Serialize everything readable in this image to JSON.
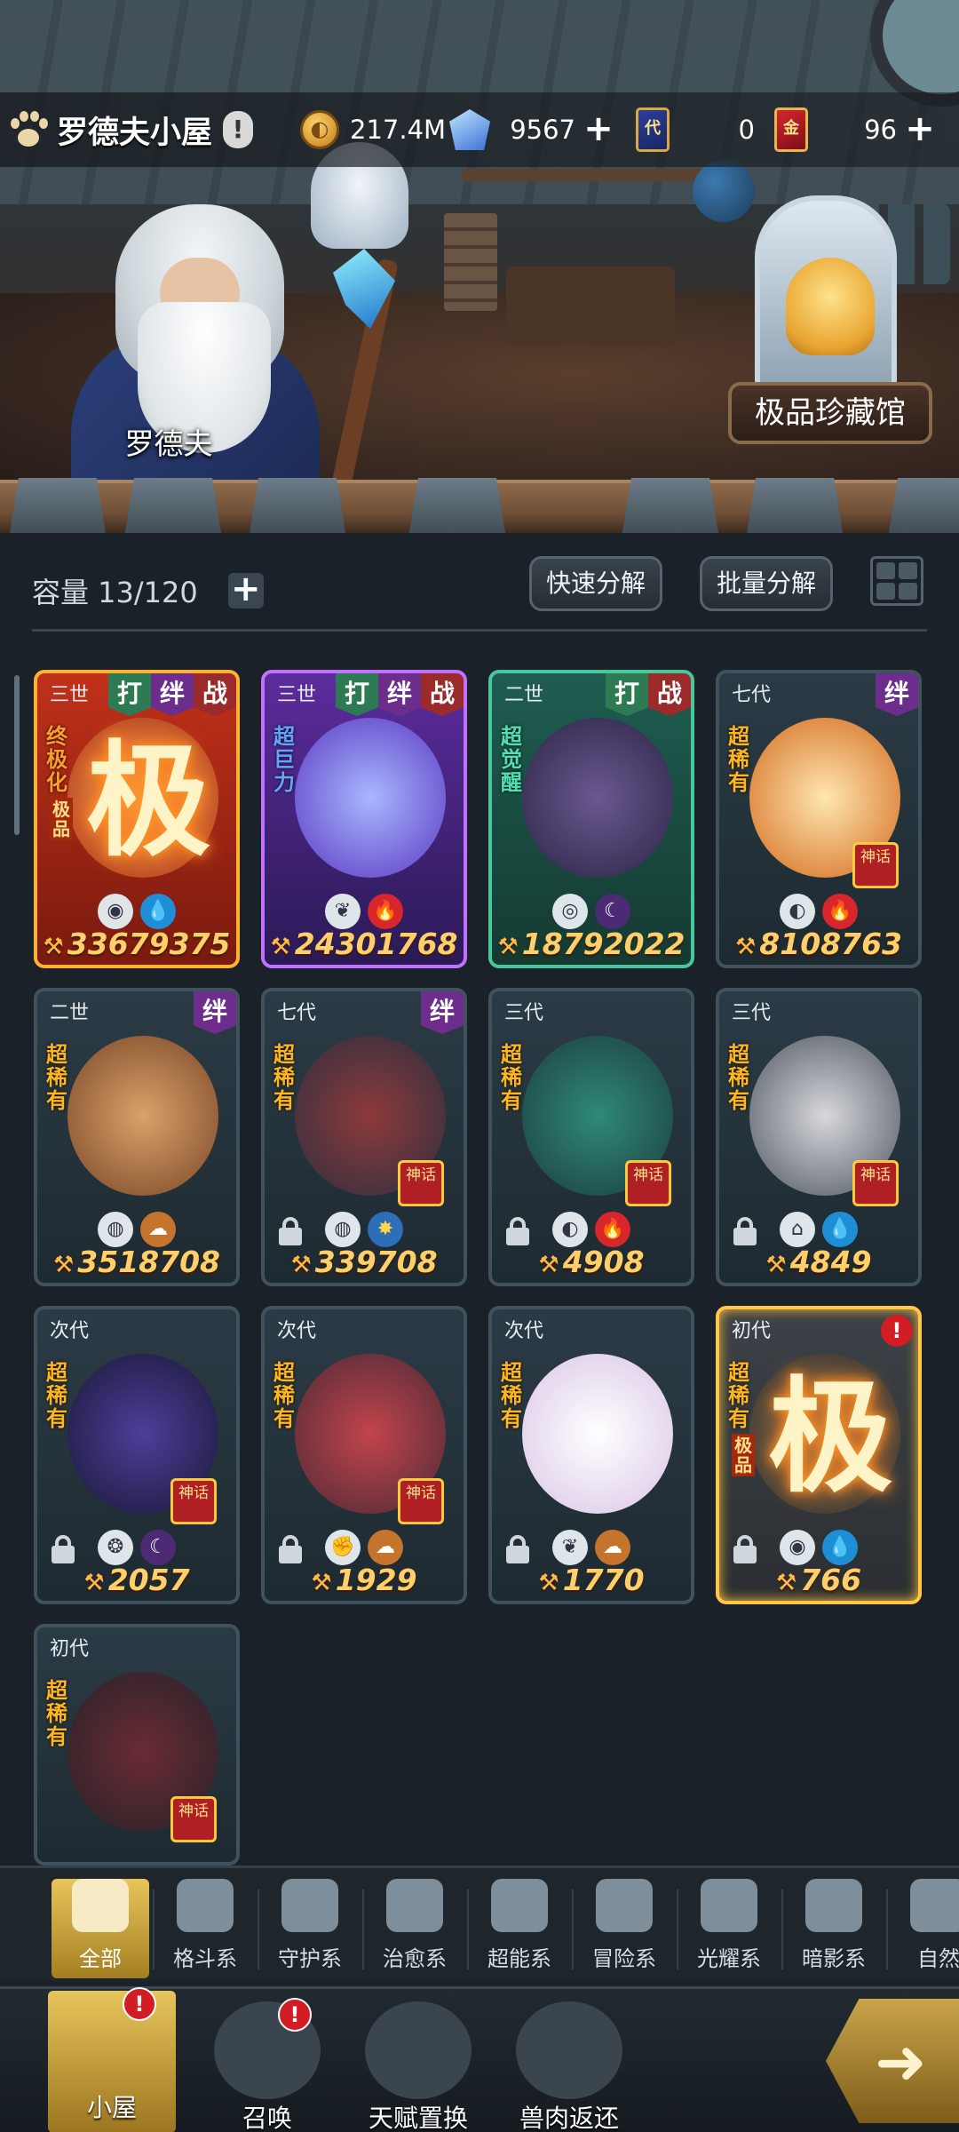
{
  "header": {
    "title": "罗德夫小屋",
    "warn": "!",
    "coins": "217.4M",
    "crystals": "9567",
    "gen_cards": "0",
    "gen_card_icon": "代",
    "gold_cards": "96",
    "gold_card_icon": "金"
  },
  "scene": {
    "npc_name": "罗德夫",
    "museum_label": "极品珍藏馆"
  },
  "toolbar": {
    "capacity_label": "容量 13/120",
    "quick_dismantle": "快速分解",
    "batch_dismantle": "批量分解"
  },
  "cards": [
    {
      "gen": "三世",
      "tags": [
        "打",
        "绊",
        "战"
      ],
      "rarity": "终极化",
      "sub": "极品",
      "big": "极",
      "elements": [
        "◉",
        "💧"
      ],
      "power": "33679375"
    },
    {
      "gen": "三世",
      "tags": [
        "打",
        "绊",
        "战"
      ],
      "rarity": "超巨力",
      "elements": [
        "❦",
        "🔥"
      ],
      "power": "24301768"
    },
    {
      "gen": "二世",
      "tags": [
        "打",
        "战"
      ],
      "rarity": "超觉醒",
      "elements": [
        "◎",
        "☾"
      ],
      "power": "18792022"
    },
    {
      "gen": "七代",
      "tags": [
        "绊"
      ],
      "rarity": "超稀有",
      "mythic": "神话",
      "elements": [
        "◐",
        "🔥"
      ],
      "power": "8108763"
    },
    {
      "gen": "二世",
      "tags": [
        "绊"
      ],
      "rarity": "超稀有",
      "elements": [
        "◍",
        "☁"
      ],
      "power": "3518708"
    },
    {
      "gen": "七代",
      "tags": [
        "绊"
      ],
      "rarity": "超稀有",
      "mythic": "神话",
      "elements": [
        "◍",
        "✸"
      ],
      "power": "339708"
    },
    {
      "gen": "三代",
      "tags": [],
      "rarity": "超稀有",
      "mythic": "神话",
      "elements": [
        "◐",
        "🔥"
      ],
      "power": "4908"
    },
    {
      "gen": "三代",
      "tags": [],
      "rarity": "超稀有",
      "mythic": "神话",
      "elements": [
        "⌂",
        "💧"
      ],
      "power": "4849"
    },
    {
      "gen": "次代",
      "tags": [],
      "rarity": "超稀有",
      "mythic": "神话",
      "elements": [
        "❂",
        "☾"
      ],
      "power": "2057"
    },
    {
      "gen": "次代",
      "tags": [],
      "rarity": "超稀有",
      "mythic": "神话",
      "elements": [
        "✊",
        "☁"
      ],
      "power": "1929"
    },
    {
      "gen": "次代",
      "tags": [],
      "rarity": "超稀有",
      "elements": [
        "❦",
        "☁"
      ],
      "power": "1770"
    },
    {
      "gen": "初代",
      "tags": [],
      "rarity": "超稀有",
      "sub": "极品",
      "big": "极",
      "elements": [
        "◉",
        "💧"
      ],
      "power": "766",
      "alert": "!"
    },
    {
      "gen": "初代",
      "tags": [],
      "rarity": "超稀有",
      "mythic": "神话",
      "elements": [],
      "power": ""
    }
  ],
  "categories": [
    "全部",
    "格斗系",
    "守护系",
    "治愈系",
    "超能系",
    "冒险系",
    "光耀系",
    "暗影系",
    "自然"
  ],
  "nav": [
    {
      "label": "小屋",
      "badge": "!"
    },
    {
      "label": "召唤",
      "badge": "!"
    },
    {
      "label": "天赋置换",
      "badge": ""
    },
    {
      "label": "兽肉返还",
      "badge": ""
    }
  ],
  "colors": {
    "accent_gold": "#e7c55a",
    "power_text": "#ffcf6b",
    "badge_red": "#d21d25"
  }
}
